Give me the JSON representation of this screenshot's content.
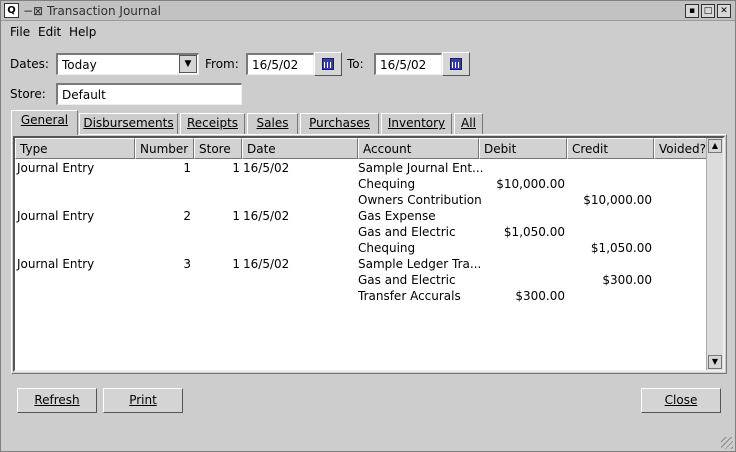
{
  "window": {
    "title": "Transaction Journal",
    "title_prefix": "−⊠",
    "app_icon": "Q",
    "controls": [
      "minimize-icon",
      "maximize-icon",
      "close-icon"
    ]
  },
  "menu": {
    "file": "File",
    "edit": "Edit",
    "help": "Help"
  },
  "filters": {
    "dates_label": "Dates:",
    "dates_value": "Today",
    "from_label": "From:",
    "from_value": "16/5/02",
    "to_label": "To:",
    "to_value": "16/5/02",
    "store_label": "Store:",
    "store_value": "Default"
  },
  "tabs": [
    "General",
    "Disbursements",
    "Receipts",
    "Sales",
    "Purchases",
    "Inventory",
    "All"
  ],
  "active_tab": "General",
  "columns": [
    "Type",
    "Number",
    "Store",
    "Date",
    "Account",
    "Debit",
    "Credit",
    "Voided?"
  ],
  "rows": [
    {
      "type": "Journal Entry",
      "number": "1",
      "store": "1",
      "date": "16/5/02",
      "account": "Sample Journal Ent...",
      "debit": "",
      "credit": ""
    },
    {
      "type": "",
      "number": "",
      "store": "",
      "date": "",
      "account": "Chequing",
      "debit": "$10,000.00",
      "credit": ""
    },
    {
      "type": "",
      "number": "",
      "store": "",
      "date": "",
      "account": "Owners Contribution",
      "debit": "",
      "credit": "$10,000.00"
    },
    {
      "type": "Journal Entry",
      "number": "2",
      "store": "1",
      "date": "16/5/02",
      "account": "Gas Expense",
      "debit": "",
      "credit": ""
    },
    {
      "type": "",
      "number": "",
      "store": "",
      "date": "",
      "account": "Gas and Electric",
      "debit": "$1,050.00",
      "credit": ""
    },
    {
      "type": "",
      "number": "",
      "store": "",
      "date": "",
      "account": "Chequing",
      "debit": "",
      "credit": "$1,050.00"
    },
    {
      "type": "Journal Entry",
      "number": "3",
      "store": "1",
      "date": "16/5/02",
      "account": "Sample Ledger Tra...",
      "debit": "",
      "credit": ""
    },
    {
      "type": "",
      "number": "",
      "store": "",
      "date": "",
      "account": "Gas and Electric",
      "debit": "",
      "credit": "$300.00"
    },
    {
      "type": "",
      "number": "",
      "store": "",
      "date": "",
      "account": "Transfer Accurals",
      "debit": "$300.00",
      "credit": ""
    }
  ],
  "buttons": {
    "refresh": "Refresh",
    "print": "Print",
    "close": "Close"
  },
  "colors": {
    "window_bg": "#cdcdcd",
    "calendar_icon": "#3a3aa8"
  }
}
